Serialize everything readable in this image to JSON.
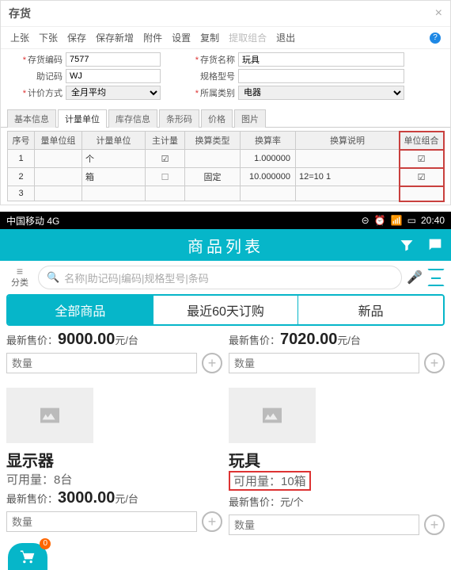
{
  "dialog": {
    "title": "存货",
    "close": "×"
  },
  "toolbar": {
    "prev": "上张",
    "next": "下张",
    "save": "保存",
    "save_new": "保存新增",
    "attach": "附件",
    "settings": "设置",
    "copy": "复制",
    "extract": "提取组合",
    "exit": "退出"
  },
  "form": {
    "code_label": "存货编码",
    "code_value": "7577",
    "name_label": "存货名称",
    "name_value": "玩具",
    "mnemonic_label": "助记码",
    "mnemonic_value": "WJ",
    "spec_label": "规格型号",
    "spec_value": "",
    "valuation_label": "计价方式",
    "valuation_value": "全月平均",
    "category_label": "所属类别",
    "category_value": "电器"
  },
  "subtabs": {
    "basic": "基本信息",
    "uom": "计量单位",
    "stock": "库存信息",
    "barcode": "条形码",
    "price": "价格",
    "image": "图片"
  },
  "grid": {
    "h_seq": "序号",
    "h_group": "量单位组",
    "h_uom": "计量单位",
    "h_main": "主计量",
    "h_convtype": "换算类型",
    "h_rate": "换算率",
    "h_desc": "换算说明",
    "h_combo": "单位组合",
    "rows": [
      {
        "seq": "1",
        "group": "",
        "uom": "个",
        "main": true,
        "convtype": "",
        "rate": "1.000000",
        "desc": "",
        "combo": true
      },
      {
        "seq": "2",
        "group": "",
        "uom": "箱",
        "main": false,
        "convtype": "固定",
        "rate": "10.000000",
        "desc": "12=10 1",
        "combo": true
      },
      {
        "seq": "3",
        "group": "",
        "uom": "",
        "main": null,
        "convtype": "",
        "rate": "",
        "desc": "",
        "combo": null
      }
    ]
  },
  "mobile": {
    "carrier": "中国移动 4G",
    "time": "20:40",
    "header_title": "商品列表",
    "category_label": "分类",
    "search_placeholder": "名称|助记码|编码|规格型号|条码",
    "seg_all": "全部商品",
    "seg_recent": "最近60天订购",
    "seg_new": "新品",
    "price_label": "最新售价：",
    "qty_placeholder": "数量",
    "avail_label": "可用量：",
    "cart_badge": "0",
    "cards_top": [
      {
        "price": "9000.00",
        "unit": "元/台"
      },
      {
        "price": "7020.00",
        "unit": "元/台"
      }
    ],
    "cards_bottom": [
      {
        "name": "显示器",
        "avail": "8台",
        "price": "3000.00",
        "unit": "元/台",
        "highlight": false
      },
      {
        "name": "玩具",
        "avail": "10箱",
        "price": "",
        "unit": "元/个",
        "highlight": true
      }
    ]
  }
}
